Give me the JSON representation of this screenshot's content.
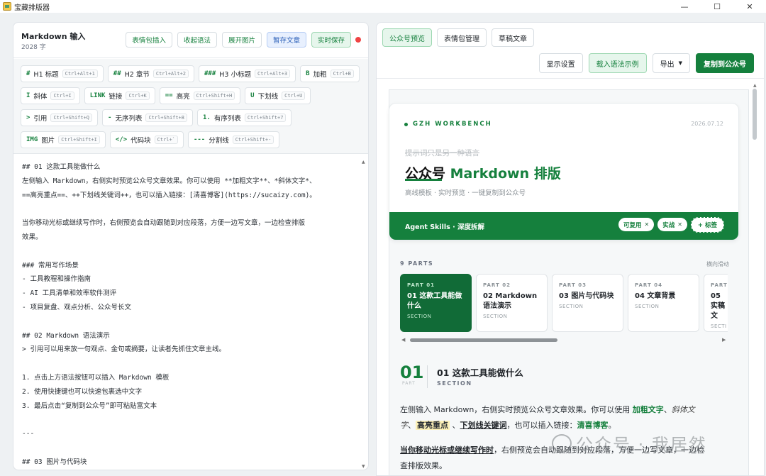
{
  "window": {
    "title": "宝藏排版器",
    "controls": [
      "—",
      "☐",
      "✕"
    ]
  },
  "left": {
    "title": "Markdown 输入",
    "count": "2028 字",
    "buttons": {
      "emoji": "表情包插入",
      "collapse": "收起语法",
      "expand_images": "展开图片",
      "stash": "暂存文章",
      "autosave": "实时保存"
    },
    "syntax": [
      [
        {
          "md": "#",
          "name": "H1 标题",
          "kb": "Ctrl+Alt+1"
        },
        {
          "md": "##",
          "name": "H2 章节",
          "kb": "Ctrl+Alt+2"
        },
        {
          "md": "###",
          "name": "H3 小标题",
          "kb": "Ctrl+Alt+3"
        },
        {
          "md": "B",
          "name": "加粗",
          "kb": "Ctrl+B"
        }
      ],
      [
        {
          "md": "I",
          "name": "斜体",
          "kb": "Ctrl+I"
        },
        {
          "md": "LINK",
          "name": "链接",
          "kb": "Ctrl+K"
        },
        {
          "md": "==",
          "name": "高亮",
          "kb": "Ctrl+Shift+H"
        },
        {
          "md": "U",
          "name": "下划线",
          "kb": "Ctrl+U"
        }
      ],
      [
        {
          "md": ">",
          "name": "引用",
          "kb": "Ctrl+Shift+Q"
        },
        {
          "md": "-",
          "name": "无序列表",
          "kb": "Ctrl+Shift+8"
        },
        {
          "md": "1.",
          "name": "有序列表",
          "kb": "Ctrl+Shift+7"
        }
      ],
      [
        {
          "md": "IMG",
          "name": "图片",
          "kb": "Ctrl+Shift+I"
        },
        {
          "md": "</>",
          "name": "代码块",
          "kb": "Ctrl+`"
        },
        {
          "md": "---",
          "name": "分割线",
          "kb": "Ctrl+Shift+-"
        }
      ]
    ],
    "editor_lines": [
      "## 01 这款工具能做什么",
      "左侧输入 Markdown，右侧实时预览公众号文章效果。你可以使用 **加粗文字**、*斜体文字*、",
      "==高亮重点==、++下划线关键词++，也可以插入链接：[清喜博客](https://sucaizy.com)。",
      "",
      "当你移动光标或继续写作时，右侧预览会自动跟随到对应段落，方便一边写文章，一边检查排版",
      "效果。",
      "",
      "### 常用写作场景",
      "- 工具教程和操作指南",
      "- AI 工具清单和效率软件测评",
      "- 项目复盘、观点分析、公众号长文",
      "",
      "## 02 Markdown 语法演示",
      "> 引用可以用来放一句观点、金句或摘要，让读者先抓住文章主线。",
      "",
      "1. 点击上方语法按钮可以插入 Markdown 模板",
      "2. 使用快捷键也可以快速包裹选中文字",
      "3. 最后点击“复制到公众号”即可粘贴富文本",
      "",
      "---",
      "",
      "## 03 图片与代码块"
    ]
  },
  "right": {
    "tabs": [
      "公众号预览",
      "表情包管理",
      "草稿文章"
    ],
    "toolbar": {
      "display": "显示设置",
      "load_example": "载入语法示例",
      "export": "导出",
      "copy": "复制到公众号"
    },
    "hero": {
      "brand": "GZH WORKBENCH",
      "date": "2026.07.12",
      "strike": "提示词只是另一种语言",
      "title_a": "公众号 ",
      "title_b": "Markdown 排版",
      "subtitle": "高线模板 · 实时预览 · 一键复制到公众号",
      "band": "Agent Skills · 深度拆解",
      "tags": [
        "可复用",
        "实战"
      ],
      "add_tag": "+ 标签"
    },
    "parts": {
      "label": "9 PARTS",
      "hint": "横向滑动",
      "cards": [
        {
          "part": "PART 01",
          "title": "01 这款工具能做什么",
          "section": "SECTION"
        },
        {
          "part": "PART 02",
          "title": "02 Markdown 语法演示",
          "section": "SECTION"
        },
        {
          "part": "PART 03",
          "title": "03 图片与代码块",
          "section": "SECTION"
        },
        {
          "part": "PART 04",
          "title": "04 文章背景",
          "section": "SECTION"
        },
        {
          "part": "PART",
          "title": "05 实稿文",
          "section": "SECTI"
        }
      ]
    },
    "section": {
      "num": "01",
      "part": "PART",
      "title": "01 这款工具能做什么",
      "label": "SECTION"
    },
    "p1": {
      "a": "左侧输入 Markdown，右侧实时预览公众号文章效果。你可以使用 ",
      "bold": "加粗文字",
      "b": "、",
      "italic": "斜体文",
      "c": "字",
      "d": "、",
      "highlight": "高亮重点",
      "e": " 、",
      "underline": "下划线关键词",
      "f": "，也可以插入链接：",
      "link": "清喜博客",
      "g": "。"
    },
    "p2": {
      "bold": "当你移动光标或继续写作时",
      "a": "，右侧预览会自动跟随到对应段落，方便一边写文章，一边检",
      "b": "查排版效果。"
    },
    "watermark": "公众号 · 我居然"
  }
}
